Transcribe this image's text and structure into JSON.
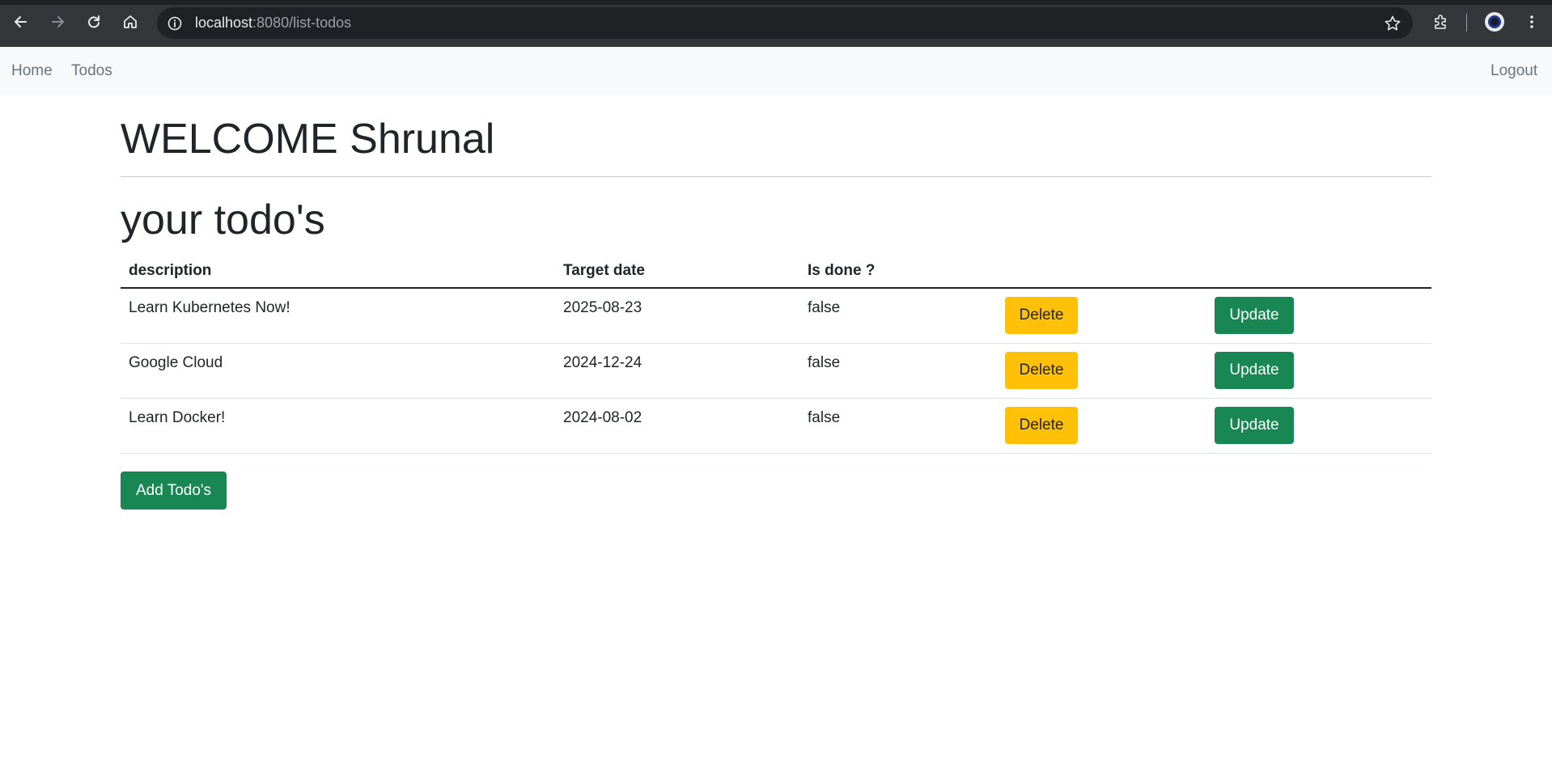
{
  "browser": {
    "url_host": "localhost",
    "url_path": ":8080/list-todos",
    "icons": [
      "back-icon",
      "forward-icon",
      "reload-icon",
      "home-icon",
      "info-icon",
      "star-icon",
      "extensions-icon",
      "profile-icon",
      "menu-icon"
    ]
  },
  "navbar": {
    "home_label": "Home",
    "todos_label": "Todos",
    "logout_label": "Logout"
  },
  "page": {
    "welcome": "WELCOME Shrunal",
    "subtitle": "your todo's"
  },
  "table": {
    "headers": {
      "description": "description",
      "target_date": "Target date",
      "is_done": "Is done ?"
    },
    "rows": [
      {
        "description": "Learn Kubernetes Now!",
        "target_date": "2025-08-23",
        "is_done": "false",
        "delete_label": "Delete",
        "update_label": "Update"
      },
      {
        "description": "Google Cloud",
        "target_date": "2024-12-24",
        "is_done": "false",
        "delete_label": "Delete",
        "update_label": "Update"
      },
      {
        "description": "Learn Docker!",
        "target_date": "2024-08-02",
        "is_done": "false",
        "delete_label": "Delete",
        "update_label": "Update"
      }
    ]
  },
  "actions": {
    "add_label": "Add Todo's"
  },
  "colors": {
    "delete_button": "#ffc107",
    "update_button": "#198754",
    "add_button": "#198754",
    "navbar_bg": "#f8f9fa",
    "browser_chrome": "#35363a"
  }
}
